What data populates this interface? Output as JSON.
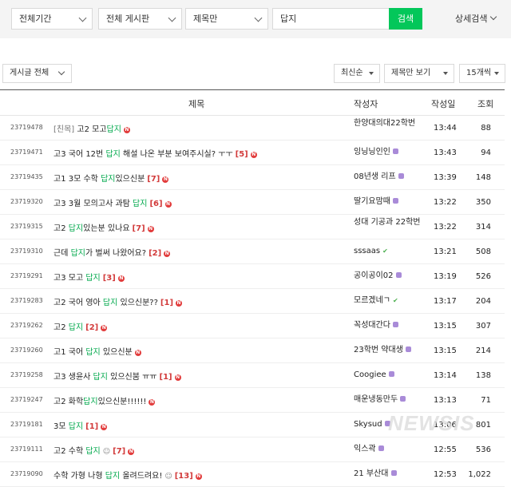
{
  "search": {
    "period": "전체기간",
    "board": "전체 게시판",
    "scope": "제목만",
    "keyword": "답지",
    "search_button": "검색",
    "advanced": "상세검색"
  },
  "filters": {
    "all_posts": "게시글 전체",
    "sort": "최신순",
    "view": "제목만 보기",
    "per_page": "15개씩"
  },
  "table": {
    "headers": {
      "title": "제목",
      "author": "작성자",
      "date": "작성일",
      "views": "조회"
    },
    "rows": [
      {
        "no": "23719478",
        "prefix": "[친목]",
        "parts": [
          {
            "t": " 고2 모고"
          },
          {
            "t": "답지",
            "hl": true
          }
        ],
        "count": "",
        "new": true,
        "author": "한양대의대22학번",
        "author_wrap": true,
        "level": "none",
        "time": "13:44",
        "views": "88"
      },
      {
        "no": "23719471",
        "parts": [
          {
            "t": "고3 국어 12번 "
          },
          {
            "t": "답지",
            "hl": true
          },
          {
            "t": " 해설 나온 부분 보여주시실? ㅜㅜ"
          }
        ],
        "count": "[5]",
        "new": true,
        "author": "잉닝닝인인",
        "level": "purple",
        "time": "13:43",
        "views": "94"
      },
      {
        "no": "23719435",
        "parts": [
          {
            "t": "고1 3모 수학 "
          },
          {
            "t": "답지",
            "hl": true
          },
          {
            "t": "있으신분"
          }
        ],
        "count": "[7]",
        "new": true,
        "author": "08년생 리프",
        "level": "purple",
        "time": "13:39",
        "views": "148"
      },
      {
        "no": "23719320",
        "parts": [
          {
            "t": "고3 3월 모의고사 과탐 "
          },
          {
            "t": "답지",
            "hl": true
          }
        ],
        "count": "[6]",
        "new": true,
        "author": "딸기요맘때",
        "level": "purple",
        "time": "13:22",
        "views": "350"
      },
      {
        "no": "23719315",
        "parts": [
          {
            "t": "고2 "
          },
          {
            "t": "답지",
            "hl": true
          },
          {
            "t": "있는분 있나요"
          }
        ],
        "count": "[7]",
        "new": true,
        "author": "성대 기공과 22학번",
        "author_wrap": true,
        "level": "none",
        "time": "13:22",
        "views": "314"
      },
      {
        "no": "23719310",
        "parts": [
          {
            "t": "근데 "
          },
          {
            "t": "답지",
            "hl": true
          },
          {
            "t": "가 벌써 나왔어요?"
          }
        ],
        "count": "[2]",
        "new": true,
        "author": "sssaas",
        "level": "green",
        "time": "13:21",
        "views": "508"
      },
      {
        "no": "23719291",
        "parts": [
          {
            "t": "고3 모고 "
          },
          {
            "t": "답지",
            "hl": true
          }
        ],
        "count": "[3]",
        "new": true,
        "author": "공이공이02",
        "level": "purple",
        "time": "13:19",
        "views": "526"
      },
      {
        "no": "23719283",
        "parts": [
          {
            "t": "고2 국어 영아 "
          },
          {
            "t": "답지",
            "hl": true
          },
          {
            "t": " 있으신분??"
          }
        ],
        "count": "[1]",
        "new": true,
        "author": "모르겠네ㄱ",
        "level": "green",
        "time": "13:17",
        "views": "204"
      },
      {
        "no": "23719262",
        "parts": [
          {
            "t": "고2 "
          },
          {
            "t": "답지",
            "hl": true
          }
        ],
        "count": "[2]",
        "new": true,
        "author": "꼭성대간다",
        "level": "purple",
        "time": "13:15",
        "views": "307"
      },
      {
        "no": "23719260",
        "parts": [
          {
            "t": "고1 국어 "
          },
          {
            "t": "답지",
            "hl": true
          },
          {
            "t": " 있으신분"
          }
        ],
        "count": "",
        "new": true,
        "author": "23학번 약대생",
        "level": "purple",
        "time": "13:15",
        "views": "214"
      },
      {
        "no": "23719258",
        "parts": [
          {
            "t": "고3 생윤사 "
          },
          {
            "t": "답지",
            "hl": true
          },
          {
            "t": " 있으신붐 ㅠㅠ"
          }
        ],
        "count": "[1]",
        "new": true,
        "author": "Coogiee",
        "level": "purple",
        "time": "13:14",
        "views": "138"
      },
      {
        "no": "23719247",
        "parts": [
          {
            "t": "고2 화학"
          },
          {
            "t": "답지",
            "hl": true
          },
          {
            "t": "있으신분!!!!!!"
          }
        ],
        "count": "",
        "new": true,
        "author": "매운냉동만두",
        "level": "purple",
        "time": "13:13",
        "views": "71"
      },
      {
        "no": "23719181",
        "parts": [
          {
            "t": "3모 "
          },
          {
            "t": "답지",
            "hl": true
          }
        ],
        "count": "[1]",
        "new": true,
        "author": "Skysud",
        "level": "purple",
        "time": "13:06",
        "views": "801"
      },
      {
        "no": "23719111",
        "parts": [
          {
            "t": "고2 수학 "
          },
          {
            "t": "답지",
            "hl": true
          }
        ],
        "emoji": true,
        "count": "[7]",
        "new": true,
        "author": "익스곽",
        "level": "purple",
        "time": "12:55",
        "views": "536"
      },
      {
        "no": "23719090",
        "parts": [
          {
            "t": "수학 가형 나형 "
          },
          {
            "t": "답지",
            "hl": true
          },
          {
            "t": " 올려드려요!"
          }
        ],
        "emoji": true,
        "count": "[13]",
        "new": true,
        "author": "21 부산대",
        "level": "purple",
        "time": "12:53",
        "views": "1,022"
      }
    ]
  },
  "watermark": "NEWSIS"
}
